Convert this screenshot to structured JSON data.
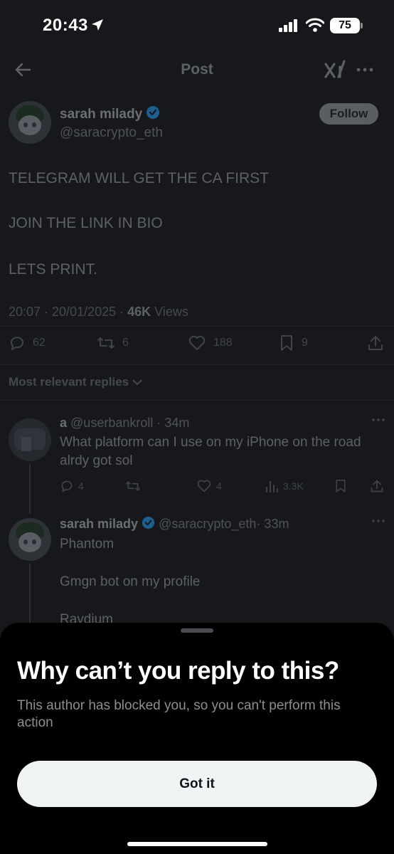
{
  "status_bar": {
    "time": "20:43",
    "battery": "75"
  },
  "nav": {
    "title": "Post"
  },
  "post": {
    "author_name": "sarah milady",
    "author_handle": "@saracrypto_eth",
    "follow_label": "Follow",
    "lines": [
      "TELEGRAM WILL GET THE CA FIRST",
      "JOIN THE LINK IN BIO",
      "LETS PRINT."
    ],
    "time": "20:07 · 20/01/2025 · ",
    "views_count": "46K",
    "views_label": " Views",
    "stats": {
      "replies": "62",
      "reposts": "6",
      "likes": "188",
      "bookmarks": "9"
    }
  },
  "replies_sort_label": "Most relevant replies",
  "replies": [
    {
      "name": "a",
      "handle": "@userbankroll",
      "time": "· 34m",
      "text": "What platform can I use on my iPhone on the road alrdy got sol",
      "stats": {
        "replies": "4",
        "likes": "4",
        "views": "3.3K"
      }
    },
    {
      "name": "sarah milady",
      "handle": "@saracrypto_eth",
      "time": "· 33m",
      "lines": [
        "Phantom",
        "Gmgn bot on my profile",
        "Raydium"
      ]
    }
  ],
  "sheet": {
    "heading": "Why can’t you reply to this?",
    "description": "This author has blocked you, so you can't perform this action",
    "button_label": "Got it"
  },
  "colors": {
    "verified": "#1d9bf0",
    "sheet_bg": "#000000",
    "button_bg": "#eff3f4"
  }
}
